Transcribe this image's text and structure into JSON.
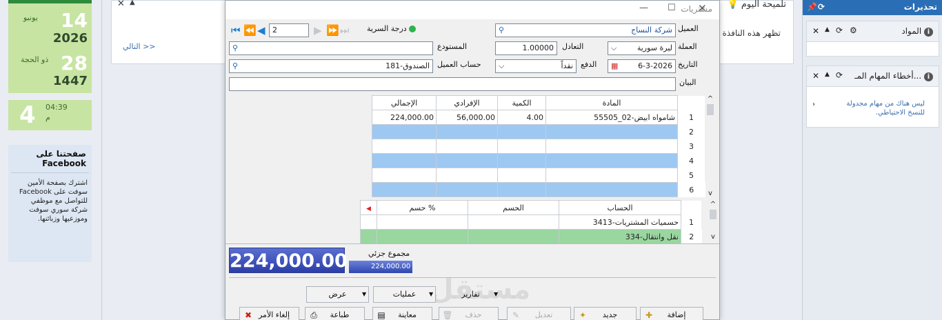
{
  "left": {
    "greg_day": "14",
    "greg_month": "يونيو",
    "greg_year": "2026",
    "hijri_day": "28",
    "hijri_month": "ذو الحجة",
    "hijri_year": "1447",
    "clock_big": "4",
    "clock_time": "04:39",
    "clock_ampm": "م",
    "fb_title": "صفحتنا على Facebook",
    "fb_text": "اشترك بصفحة الأمين سوفت على Facebook للتواصل مع موظفي شركة سوري سوفت وموزعيها وزبائنها."
  },
  "tip": {
    "title": "تلميحة اليوم",
    "show_text": "تظهر هذه النافذة",
    "next_link": "التالي >>"
  },
  "right": {
    "header": "تحذيرات",
    "box1_title": "المواد",
    "box2_title": "أخطاء المهام المـ...",
    "box2_text": "ليس هناك من مهام مجدولة للنسخ الاحتياطي."
  },
  "dialog": {
    "title": "مشتريات",
    "record_no": "2",
    "secret_label": "درجة السرية",
    "labels": {
      "customer": "العميل",
      "currency": "العملة",
      "exchange": "التعادل",
      "warehouse": "المستودع",
      "date": "التاريخ",
      "payment": "الدفع",
      "customer_account": "حساب العميل",
      "statement": "البيان"
    },
    "values": {
      "customer": "شركة النساج",
      "currency": "ليرة سورية",
      "exchange": "1.00000",
      "warehouse": "",
      "date": "6-3-2026",
      "payment": "نقداً",
      "customer_account": "181-الصندوق",
      "statement": ""
    },
    "items_headers": [
      "المادة",
      "الكمية",
      "الإفرادي",
      "الإجمالي"
    ],
    "items": [
      {
        "n": "1",
        "item": "55505_02-شامواه ابيض",
        "qty": "4.00",
        "unit": "56,000.00",
        "total": "224,000.00"
      },
      {
        "n": "2",
        "item": "",
        "qty": "",
        "unit": "",
        "total": ""
      },
      {
        "n": "3",
        "item": "",
        "qty": "",
        "unit": "",
        "total": ""
      },
      {
        "n": "4",
        "item": "",
        "qty": "",
        "unit": "",
        "total": ""
      },
      {
        "n": "5",
        "item": "",
        "qty": "",
        "unit": "",
        "total": ""
      },
      {
        "n": "6",
        "item": "",
        "qty": "",
        "unit": "",
        "total": ""
      }
    ],
    "disc_headers": [
      "الحساب",
      "الحسم",
      "حسم %"
    ],
    "discounts": [
      {
        "n": "1",
        "account": "3413-حسميات المشتريات",
        "disc": "",
        "pct": ""
      },
      {
        "n": "2",
        "account": "334-نقل وانتقال",
        "disc": "",
        "pct": ""
      }
    ],
    "subtotal_label": "مجموع جزئي",
    "total_big": "224,000.00",
    "total_small": "224,000.00",
    "menus": {
      "view": "عرض",
      "operations": "عمليات",
      "reports": "تقارير"
    },
    "buttons": {
      "add": "إضافة",
      "new": "جديد",
      "edit": "تعديل",
      "delete": "حذف",
      "preview": "معاينة",
      "print": "طباعة",
      "cancel": "إلغاء الأمر"
    },
    "watermark": "مستقل"
  }
}
